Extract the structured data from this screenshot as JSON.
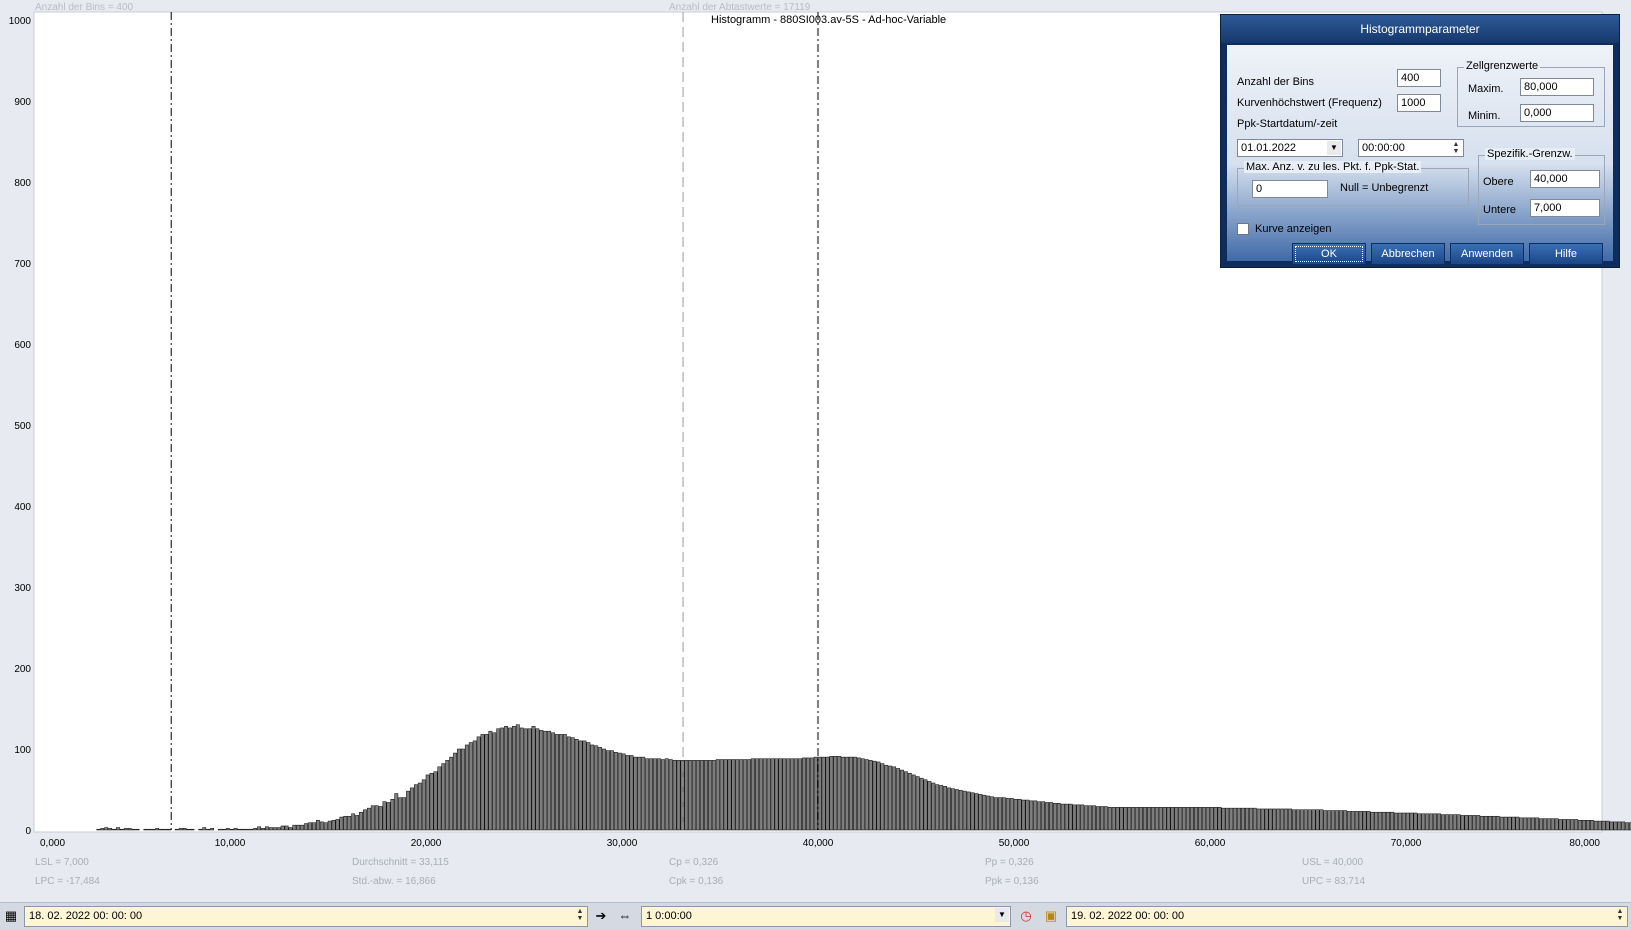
{
  "header": {
    "bins_info": "Anzahl der Bins =   400",
    "samples_info": "Anzahl der Abtastwerte = 17119",
    "chart_title": "Histogramm - 880SI003.av-5S - Ad-hoc-Variable"
  },
  "chart_data": {
    "type": "bar",
    "title": "Histogramm - 880SI003.av-5S - Ad-hoc-Variable",
    "xlim": [
      0,
      80
    ],
    "ylim": [
      0,
      1000
    ],
    "x_ticks": [
      "0,000",
      "10,000",
      "20,000",
      "30,000",
      "40,000",
      "50,000",
      "60,000",
      "70,000",
      "80,000"
    ],
    "y_ticks": [
      "0",
      "100",
      "200",
      "300",
      "400",
      "500",
      "600",
      "700",
      "800",
      "900",
      "1000"
    ],
    "bin_width": 0.2,
    "x_start": 0,
    "values": [
      0,
      0,
      0,
      0,
      0,
      0,
      0,
      0,
      0,
      0,
      0,
      0,
      0,
      0,
      0,
      0,
      1,
      2,
      3,
      2,
      1,
      3,
      1,
      2,
      2,
      1,
      1,
      0,
      1,
      1,
      1,
      2,
      1,
      1,
      1,
      0,
      1,
      2,
      2,
      1,
      1,
      0,
      1,
      3,
      1,
      2,
      0,
      1,
      1,
      2,
      1,
      2,
      1,
      1,
      1,
      1,
      2,
      4,
      2,
      4,
      3,
      3,
      3,
      5,
      5,
      3,
      6,
      6,
      6,
      8,
      9,
      9,
      12,
      10,
      9,
      11,
      12,
      13,
      16,
      17,
      17,
      20,
      18,
      22,
      25,
      27,
      30,
      30,
      29,
      35,
      34,
      38,
      45,
      40,
      40,
      48,
      52,
      56,
      58,
      62,
      68,
      70,
      72,
      78,
      82,
      86,
      90,
      95,
      100,
      100,
      105,
      108,
      110,
      115,
      118,
      118,
      122,
      120,
      125,
      126,
      128,
      126,
      128,
      130,
      126,
      125,
      125,
      128,
      125,
      123,
      122,
      122,
      120,
      118,
      118,
      118,
      115,
      114,
      112,
      110,
      110,
      108,
      105,
      104,
      102,
      100,
      98,
      98,
      96,
      95,
      94,
      92,
      92,
      90,
      90,
      90,
      88,
      88,
      88,
      88,
      87,
      88,
      87,
      86,
      86,
      86,
      86,
      86,
      86,
      86,
      86,
      86,
      86,
      86,
      87,
      87,
      87,
      87,
      87,
      87,
      87,
      87,
      87,
      88,
      88,
      88,
      88,
      88,
      88,
      88,
      88,
      88,
      88,
      88,
      88,
      88,
      89,
      89,
      89,
      90,
      90,
      90,
      90,
      91,
      91,
      91,
      90,
      90,
      90,
      90,
      89,
      88,
      87,
      86,
      85,
      84,
      82,
      80,
      79,
      78,
      76,
      74,
      72,
      70,
      68,
      66,
      64,
      62,
      60,
      58,
      56,
      55,
      54,
      52,
      51,
      50,
      49,
      48,
      47,
      46,
      45,
      44,
      43,
      42,
      41,
      40,
      40,
      40,
      39,
      39,
      38,
      38,
      37,
      37,
      36,
      36,
      35,
      35,
      34,
      34,
      33,
      33,
      32,
      32,
      32,
      31,
      31,
      31,
      30,
      30,
      30,
      29,
      29,
      29,
      28,
      28,
      28,
      28,
      28,
      28,
      28,
      28,
      28,
      28,
      28,
      28,
      28,
      28,
      28,
      28,
      28,
      28,
      28,
      28,
      28,
      28,
      28,
      28,
      28,
      28,
      28,
      28,
      28,
      27,
      27,
      27,
      27,
      27,
      27,
      27,
      27,
      27,
      26,
      26,
      26,
      26,
      26,
      26,
      26,
      26,
      26,
      25,
      25,
      25,
      25,
      25,
      25,
      25,
      25,
      24,
      24,
      24,
      24,
      24,
      24,
      23,
      23,
      23,
      23,
      23,
      23,
      22,
      22,
      22,
      22,
      22,
      22,
      21,
      21,
      21,
      21,
      21,
      21,
      20,
      20,
      20,
      20,
      20,
      20,
      19,
      19,
      19,
      19,
      19,
      18,
      18,
      18,
      18,
      18,
      17,
      17,
      17,
      17,
      17,
      16,
      16,
      16,
      16,
      16,
      15,
      15,
      15,
      15,
      15,
      14,
      14,
      14,
      14,
      14,
      13,
      13,
      13,
      13,
      13,
      12,
      12,
      12,
      12,
      11,
      11,
      11,
      11,
      10,
      10,
      10,
      10,
      9,
      9,
      9,
      9,
      8,
      8,
      8,
      8,
      7,
      7,
      7,
      7,
      6,
      6,
      6,
      6,
      5,
      5,
      5,
      5,
      4,
      4,
      4,
      4,
      3,
      3,
      3,
      3,
      2,
      2,
      0,
      0,
      0,
      0,
      0,
      0,
      0,
      0,
      0,
      0,
      0,
      0,
      0,
      0,
      0
    ],
    "reference_lines": [
      {
        "name": "LSL",
        "x": 7.0,
        "style": "dashdot"
      },
      {
        "name": "Durchschnitt",
        "x": 33.115,
        "style": "dashed"
      },
      {
        "name": "USL",
        "x": 40.0,
        "style": "dashdot"
      }
    ],
    "grid": false,
    "legend": "none"
  },
  "stats": {
    "lsl": "LSL = 7,000",
    "lpc": "LPC = -17,484",
    "mean": "Durchschnitt  = 33,115",
    "stddev": "Std.-abw. = 16,866",
    "cp": "Cp  = 0,326",
    "cpk": "Cpk = 0,136",
    "pp": "Pp  = 0,326",
    "ppk": "Ppk = 0,136",
    "usl": "USL = 40,000",
    "upc": "UPC = 83,714"
  },
  "dialog": {
    "title": "Histogrammparameter",
    "bins_label": "Anzahl der Bins",
    "bins_value": "400",
    "curve_max_label": "Kurvenhöchstwert (Frequenz)",
    "curve_max_value": "1000",
    "ppk_start_label": "Ppk-Startdatum/-zeit",
    "ppk_date": "01.01.2022",
    "ppk_time": "00:00:00",
    "cell_limits_title": "Zellgrenzwerte",
    "max_label": "Maxim.",
    "max_value": "80,000",
    "min_label": "Minim.",
    "min_value": "0,000",
    "spec_limits_title": "Spezifik.-Grenzw.",
    "upper_label": "Obere",
    "upper_value": "40,000",
    "lower_label": "Untere",
    "lower_value": "7,000",
    "max_points_title": "Max. Anz. v. zu les. Pkt. f. Ppk-Stat.",
    "max_points_value": "0",
    "max_points_hint": "Null = Unbegrenzt",
    "show_curve_label": "Kurve anzeigen",
    "show_curve_checked": false,
    "ok_label": "OK",
    "cancel_label": "Abbrechen",
    "apply_label": "Anwenden",
    "help_label": "Hilfe"
  },
  "toolbar": {
    "start_time": "18. 02. 2022   00: 00: 00",
    "duration": "1 0:00:00",
    "end_time": "19. 02. 2022   00: 00: 00"
  },
  "colors": {
    "bar_fill": "#7d7d7d",
    "bar_stroke": "#000000",
    "background": "#e7eaf0",
    "plot_area": "#ffffff",
    "dialog_frame": "#0f2d5c",
    "toolbar_field": "#fdf5d4"
  }
}
